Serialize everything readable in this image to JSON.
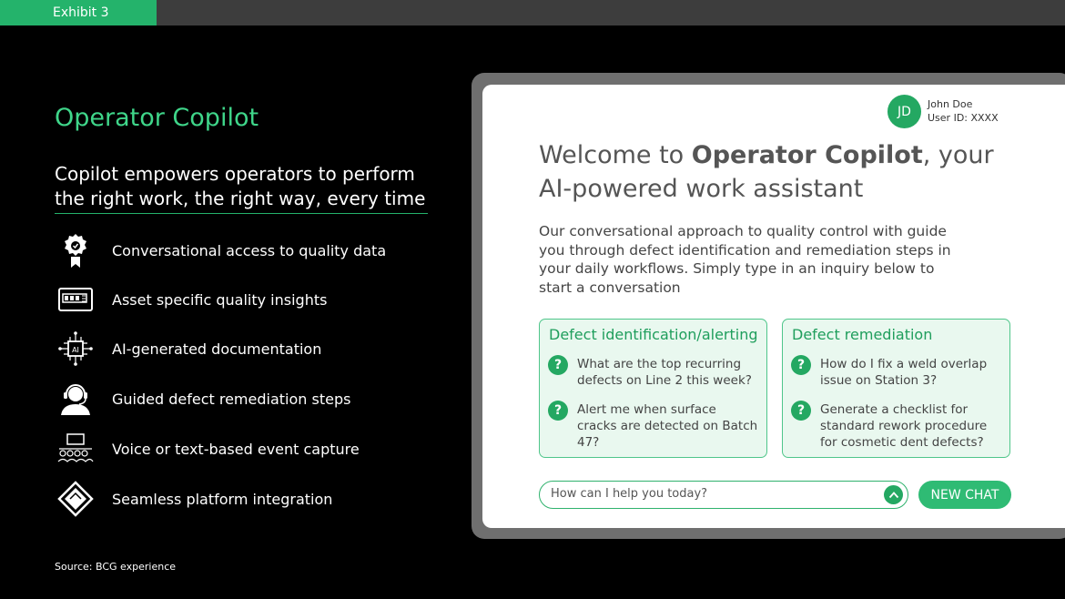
{
  "exhibit_label": "Exhibit 3",
  "left": {
    "title": "Operator Copilot",
    "subtitle": "Copilot empowers operators to perform the right work, the right way, every time",
    "features": [
      {
        "icon": "award-icon",
        "label": "Conversational access to quality data"
      },
      {
        "icon": "asset-card-icon",
        "label": "Asset specific quality insights"
      },
      {
        "icon": "ai-chip-icon",
        "label": "AI-generated documentation"
      },
      {
        "icon": "headset-operator-icon",
        "label": "Guided defect remediation steps"
      },
      {
        "icon": "voice-capture-icon",
        "label": "Voice or text-based event capture"
      },
      {
        "icon": "platform-integration-icon",
        "label": "Seamless platform integration"
      }
    ],
    "source": "Source: BCG experience"
  },
  "app": {
    "user": {
      "initials": "JD",
      "name": "John Doe",
      "id": "User ID: XXXX"
    },
    "welcome": {
      "prefix": "Welcome to ",
      "brand": "Operator Copilot",
      "suffix": ", your AI-powered work assistant"
    },
    "intro": "Our conversational approach to quality control with guide you through defect identification and remediation steps in your daily workflows. Simply type in an inquiry below to start a conversation",
    "cards": [
      {
        "title": "Defect identification/alerting",
        "questions": [
          "What are the top recurring defects on Line 2 this week?",
          "Alert me when surface cracks are detected on Batch 47?"
        ]
      },
      {
        "title": "Defect remediation",
        "questions": [
          "How do I fix a weld overlap issue on Station 3?",
          "Generate a checklist for standard rework procedure for cosmetic dent defects?"
        ]
      }
    ],
    "chat": {
      "placeholder": "How can I help you today?",
      "new_chat_label": "NEW CHAT"
    },
    "question_glyph": "?"
  },
  "colors": {
    "accent": "#24b36b",
    "title_green": "#3fd68a",
    "card_bg": "#e9f8ef",
    "background": "#000000"
  }
}
